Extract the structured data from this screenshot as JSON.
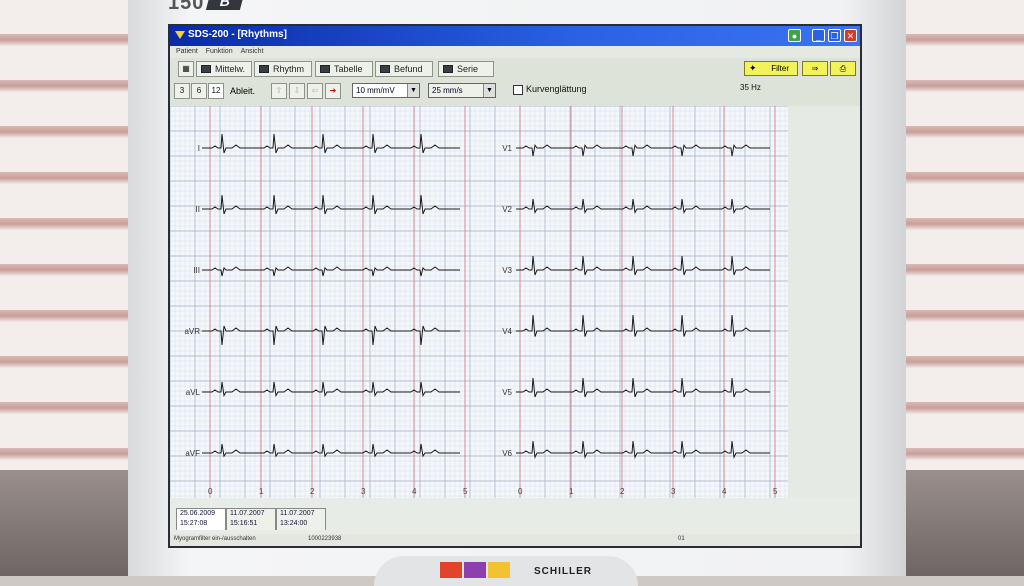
{
  "monitor": {
    "model_text": "150",
    "model_suffix": "B",
    "brand": "SCHILLER"
  },
  "window": {
    "title": "SDS-200 - [Rhythms]"
  },
  "menu": [
    "Patient",
    "Funktion",
    "Ansicht"
  ],
  "toolbar": {
    "buttons": [
      {
        "label": "Mittelw."
      },
      {
        "label": "Rhythm"
      },
      {
        "label": "Tabelle"
      },
      {
        "label": "Befund"
      },
      {
        "label": "Serie"
      }
    ],
    "filter_label": "Filter",
    "leads_options": [
      "3",
      "6",
      "12"
    ],
    "leads_label": "Ableit.",
    "amplitude_value": "10 mm/mV",
    "speed_value": "25 mm/s",
    "smoothing_label": "Kurvenglättung",
    "filter_hz": "35 Hz"
  },
  "ecg": {
    "left_leads": [
      "I",
      "II",
      "III",
      "aVR",
      "aVL",
      "aVF"
    ],
    "right_leads": [
      "V1",
      "V2",
      "V3",
      "V4",
      "V5",
      "V6"
    ],
    "time_marks": [
      "0",
      "1",
      "2",
      "3",
      "4",
      "5"
    ]
  },
  "records": [
    {
      "date": "25.06.2009",
      "time": "15:27:08"
    },
    {
      "date": "11.07.2007",
      "time": "15:16:51"
    },
    {
      "date": "11.07.2007",
      "time": "13:24:00"
    }
  ],
  "status": {
    "left": "Myogramfilter ein-/ausschalten",
    "id": "1000223938",
    "page": "01"
  },
  "colors": {
    "titlebar": "#1f4fd8",
    "filter": "#f2f25a",
    "grid_major": "#9fb1c6",
    "grid_minor": "#d3dbe6",
    "trace": "#1a1a1a",
    "second_mark": "#d97d8a"
  }
}
